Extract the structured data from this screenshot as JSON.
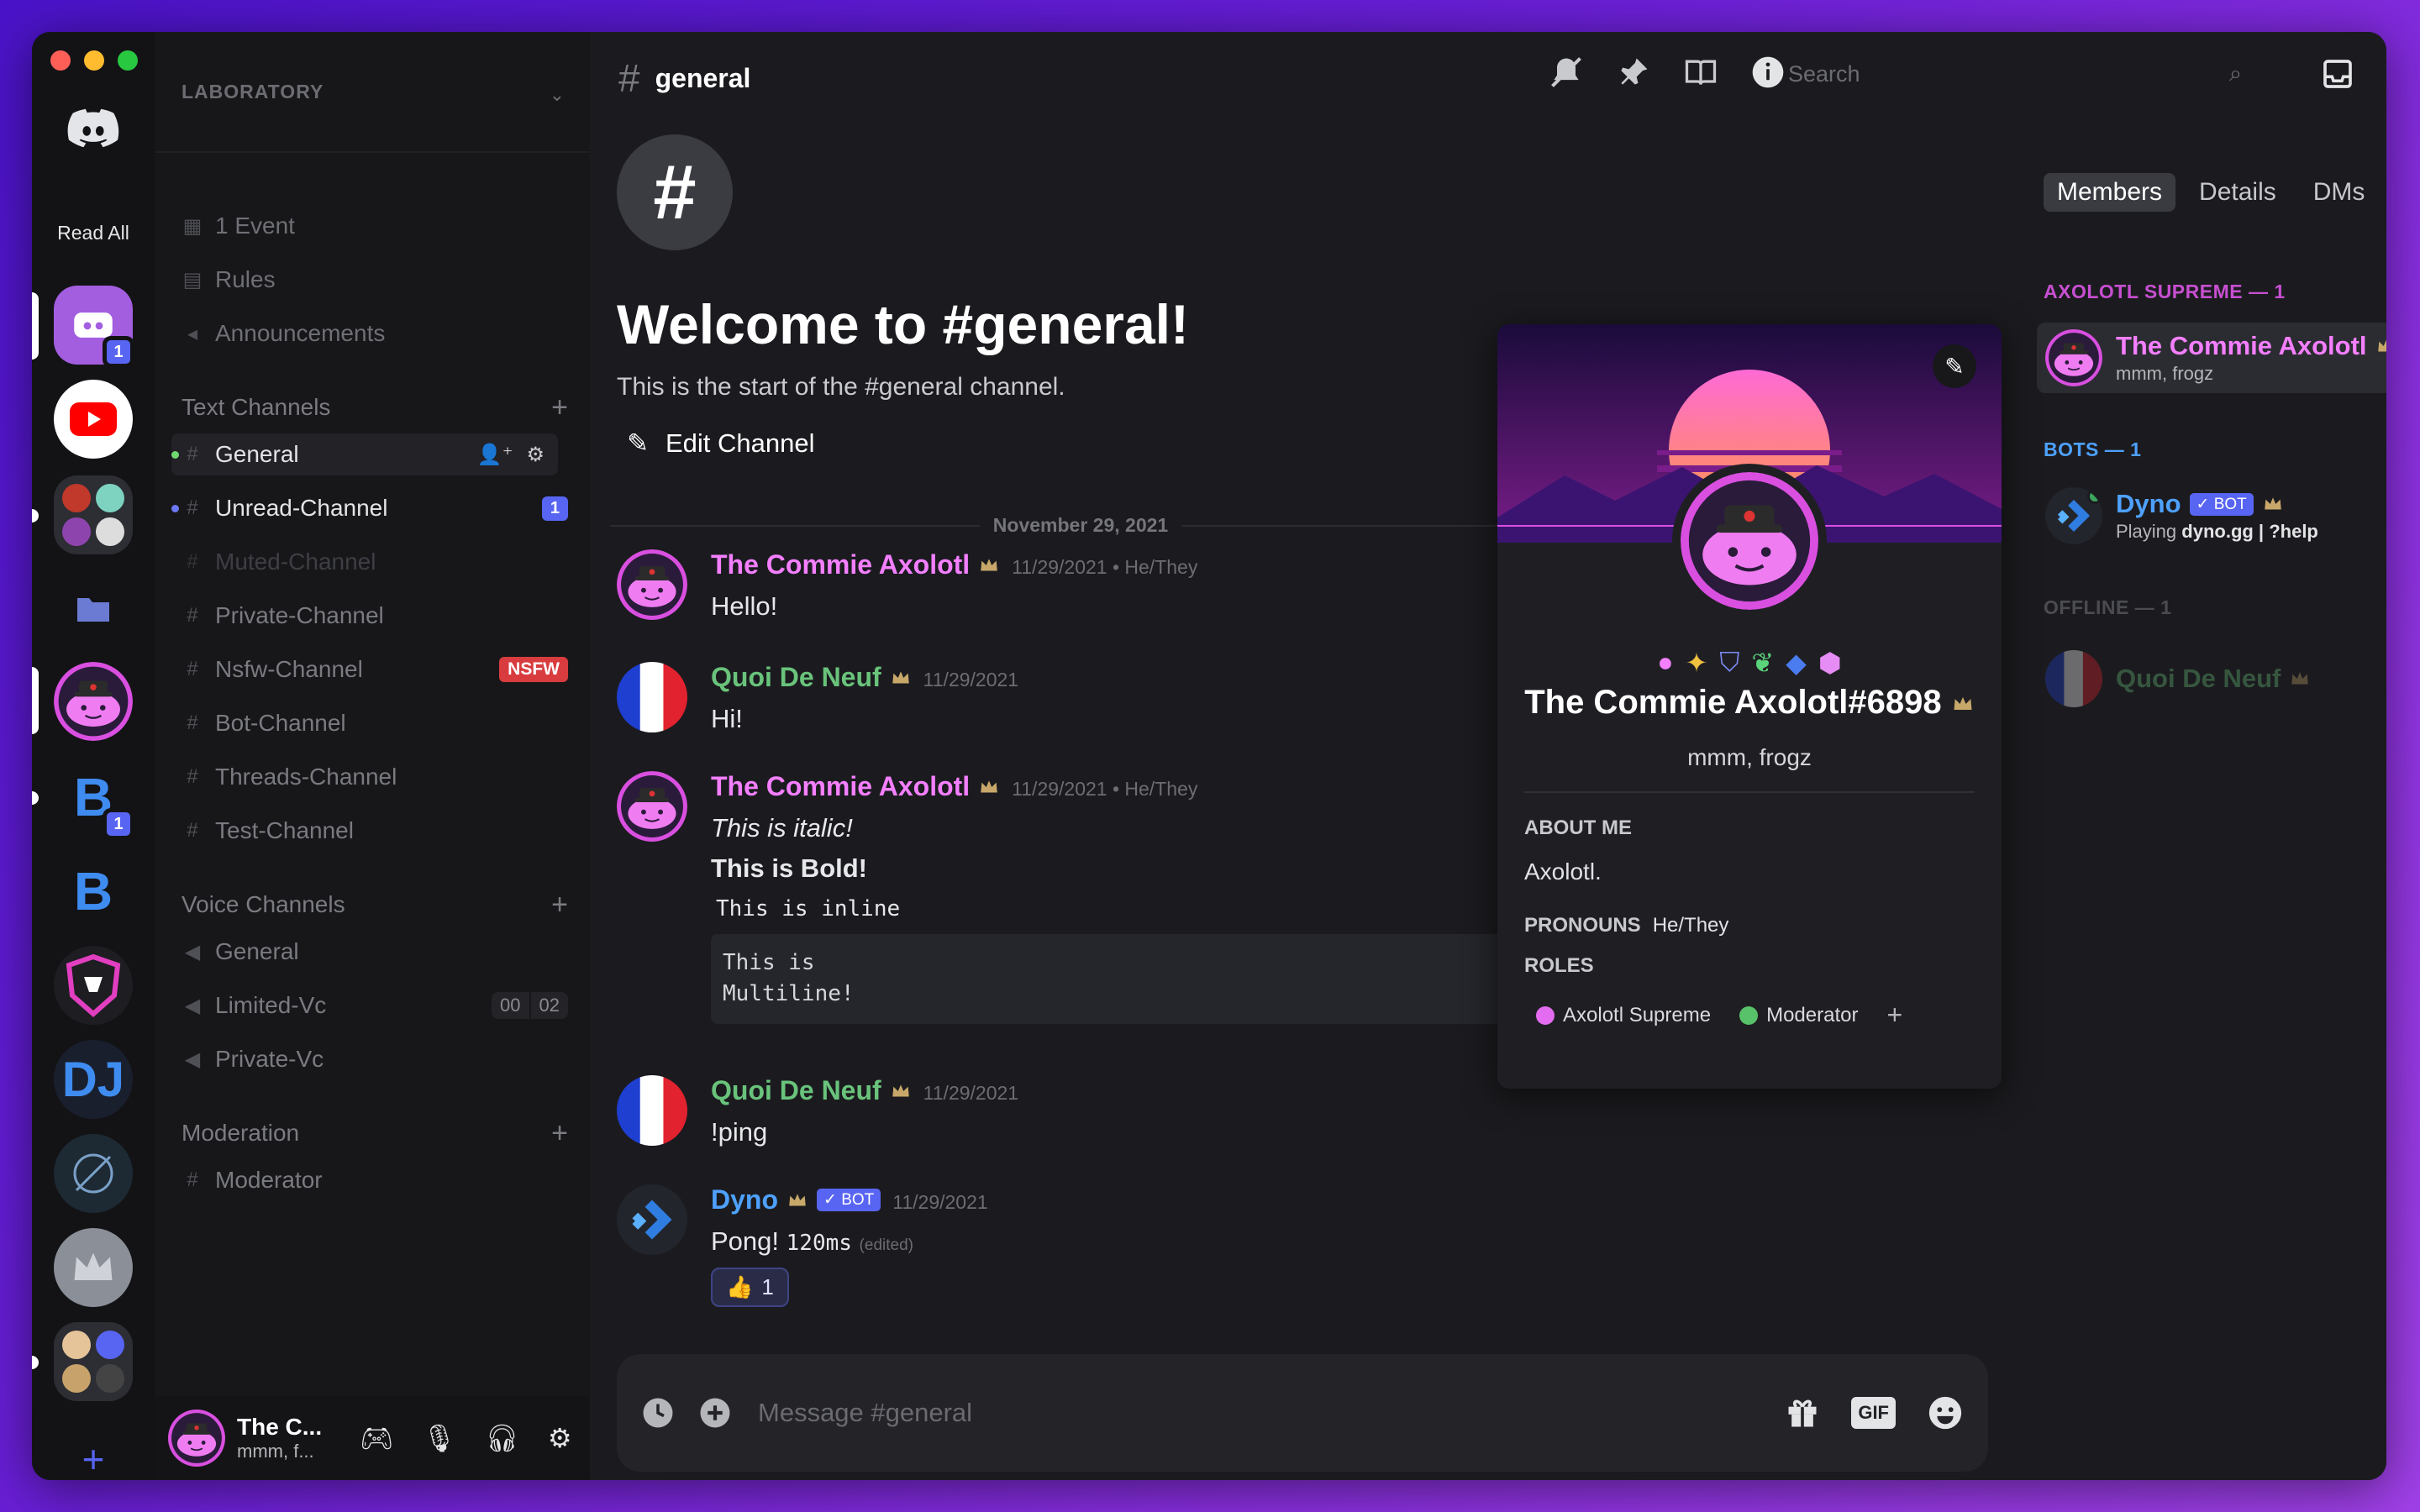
{
  "window": {
    "title": "Discord"
  },
  "colors": {
    "pink": "#f47fff",
    "green": "#69c37b",
    "blue": "#6aa7ff",
    "blurple": "#5865f2",
    "nsfw": "#d83c3e"
  },
  "guild_bar": {
    "read_all": "Read All",
    "badges": {
      "g1": "1",
      "g5": "1"
    }
  },
  "sidebar": {
    "server_name": "LABORATORY",
    "top_items": [
      {
        "label": "1 Event",
        "icon": "calendar-icon"
      },
      {
        "label": "Rules",
        "icon": "rules-icon"
      },
      {
        "label": "Announcements",
        "icon": "megaphone-icon"
      }
    ],
    "text_category": "Text Channels",
    "text_channels": [
      {
        "label": "General"
      },
      {
        "label": "Unread-Channel",
        "badge": "1"
      },
      {
        "label": "Muted-Channel"
      },
      {
        "label": "Private-Channel"
      },
      {
        "label": "Nsfw-Channel",
        "tag": "NSFW"
      },
      {
        "label": "Bot-Channel"
      },
      {
        "label": "Threads-Channel"
      },
      {
        "label": "Test-Channel"
      }
    ],
    "voice_category": "Voice Channels",
    "voice_channels": [
      {
        "label": "General"
      },
      {
        "label": "Limited-Vc",
        "count_a": "00",
        "count_b": "02"
      },
      {
        "label": "Private-Vc"
      }
    ],
    "mod_category": "Moderation",
    "mod_channels": [
      {
        "label": "Moderator"
      }
    ],
    "user": {
      "name": "The C...",
      "status": "mmm, f..."
    }
  },
  "header": {
    "channel": "general",
    "search_placeholder": "Search"
  },
  "welcome": {
    "icon": "#",
    "title": "Welcome to #general!",
    "subtitle": "This is the start of the #general channel.",
    "edit": "Edit Channel"
  },
  "date_separator": "November 29, 2021",
  "messages": [
    {
      "author": "The Commie Axolotl",
      "time": "11/29/2021 • He/They",
      "text": "Hello!"
    },
    {
      "author": "Quoi De Neuf",
      "time": "11/29/2021",
      "text": "Hi!"
    },
    {
      "author": "The Commie Axolotl",
      "time": "11/29/2021 • He/They",
      "italic": "This is italic!",
      "bold": "This is Bold!",
      "inline": "This is inline",
      "code1": "This is",
      "code2": "Multiline!"
    },
    {
      "author": "Quoi De Neuf",
      "time": "11/29/2021",
      "text": "!ping"
    },
    {
      "author": "Dyno",
      "bot_tag": "✓ BOT",
      "time": "11/29/2021",
      "text": "Pong!",
      "mono": "120ms",
      "edited": "(edited)",
      "reaction": "👍",
      "reaction_count": "1"
    }
  ],
  "composer": {
    "placeholder": "Message #general",
    "gif": "GIF"
  },
  "members_panel": {
    "tabs": [
      "Members",
      "Details",
      "DMs"
    ],
    "groups": [
      {
        "title": "AXOLOTL SUPREME — 1",
        "members": [
          {
            "name": "The Commie Axolotl",
            "status": "mmm, frogz"
          }
        ]
      },
      {
        "title": "BOTS — 1",
        "members": [
          {
            "name": "Dyno",
            "tag": "✓ BOT",
            "status_prefix": "Playing ",
            "status_bold": "dyno.gg | ?help"
          }
        ]
      },
      {
        "title": "OFFLINE — 1",
        "members": [
          {
            "name": "Quoi De Neuf"
          }
        ]
      }
    ]
  },
  "profile_card": {
    "username": "The Commie Axolotl#6898",
    "status": "mmm, frogz",
    "about_label": "ABOUT ME",
    "about": "Axolotl.",
    "pronouns_label": "PRONOUNS",
    "pronouns": "He/They",
    "roles_label": "ROLES",
    "roles": [
      {
        "name": "Axolotl Supreme",
        "color": "#e36cf0"
      },
      {
        "name": "Moderator",
        "color": "#57c26a"
      }
    ],
    "add_role": "+"
  }
}
